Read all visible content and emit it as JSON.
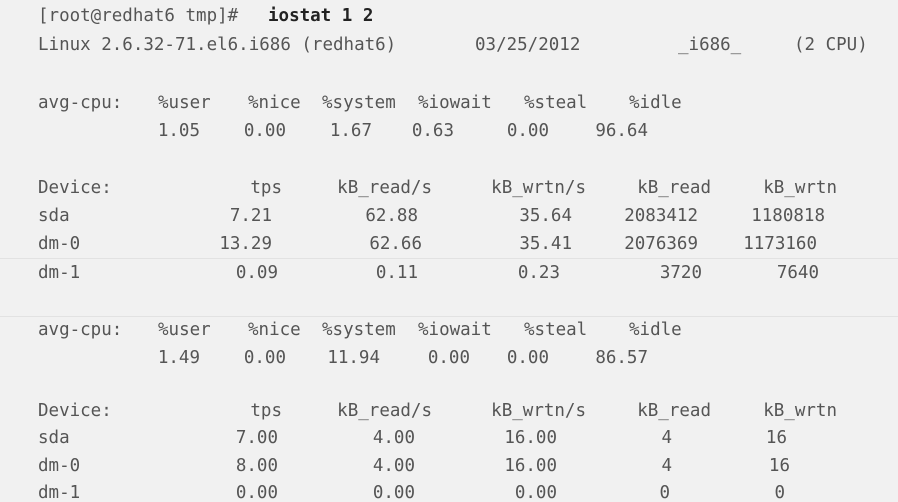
{
  "terminal": {
    "prompt": "[root@redhat6 tmp]# ",
    "command": "iostat 1 2",
    "header": {
      "kernel": "Linux 2.6.32-71.el6.i686 (redhat6)",
      "date": "03/25/2012",
      "arch": "_i686_",
      "cpus": "(2 CPU)"
    },
    "cpu_headers": [
      "avg-cpu:",
      "%user",
      "%nice",
      "%system",
      "%iowait",
      "%steal",
      "%idle"
    ],
    "device_headers": [
      "Device:",
      "tps",
      "kB_read/s",
      "kB_wrtn/s",
      "kB_read",
      "kB_wrtn"
    ],
    "reports": [
      {
        "cpu": [
          "1.05",
          "0.00",
          "1.67",
          "0.63",
          "0.00",
          "96.64"
        ],
        "devices": [
          [
            "sda",
            "7.21",
            "62.88",
            "35.64",
            "2083412",
            "1180818"
          ],
          [
            "dm-0",
            "13.29",
            "62.66",
            "35.41",
            "2076369",
            "1173160"
          ],
          [
            "dm-1",
            "0.09",
            "0.11",
            "0.23",
            "3720",
            "7640"
          ]
        ]
      },
      {
        "cpu": [
          "1.49",
          "0.00",
          "11.94",
          "0.00",
          "0.00",
          "86.57"
        ],
        "devices": [
          [
            "sda",
            "7.00",
            "4.00",
            "16.00",
            "4",
            "16"
          ],
          [
            "dm-0",
            "8.00",
            "4.00",
            "16.00",
            "4",
            "16"
          ],
          [
            "dm-1",
            "0.00",
            "0.00",
            "0.00",
            "0",
            "0"
          ]
        ]
      }
    ]
  }
}
